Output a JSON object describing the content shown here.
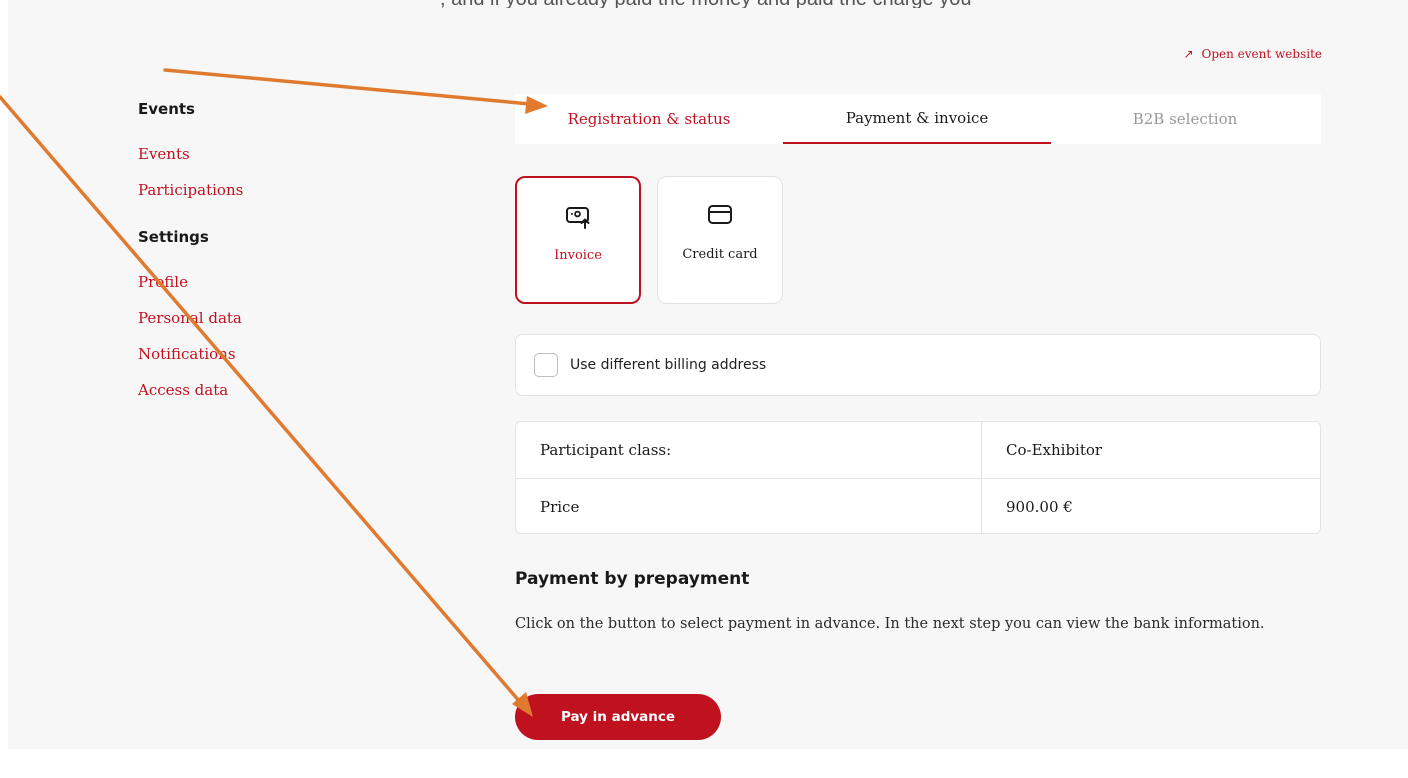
{
  "header": {
    "clipped_top_text": ", and if you already paid the money and paid the charge you",
    "open_event_website": "Open event website",
    "open_icon": "arrow-up-right-icon"
  },
  "sidebar": {
    "events_heading": "Events",
    "events_links": [
      "Events",
      "Participations"
    ],
    "settings_heading": "Settings",
    "settings_links": [
      "Profile",
      "Personal data",
      "Notifications",
      "Access data"
    ]
  },
  "tabs": [
    {
      "label": "Registration & status",
      "state": "link"
    },
    {
      "label": "Payment & invoice",
      "state": "active"
    },
    {
      "label": "B2B selection",
      "state": "disabled"
    }
  ],
  "payment_methods": [
    {
      "label": "Invoice",
      "icon": "invoice-icon",
      "selected": true
    },
    {
      "label": "Credit card",
      "icon": "credit-card-icon",
      "selected": false
    }
  ],
  "billing": {
    "label": "Use different billing address",
    "checked": false
  },
  "info": {
    "rows": [
      {
        "key": "Participant class:",
        "value": "Co-Exhibitor"
      },
      {
        "key": "Price",
        "value": "900.00 €"
      }
    ]
  },
  "prepayment": {
    "title": "Payment by prepayment",
    "text": "Click on the button to select payment in advance. In the next step you can view the bank information.",
    "button": "Pay in advance"
  },
  "colors": {
    "accent": "#c0111f",
    "annotation_arrow": "#e07a2e",
    "background": "#f7f7f7"
  }
}
